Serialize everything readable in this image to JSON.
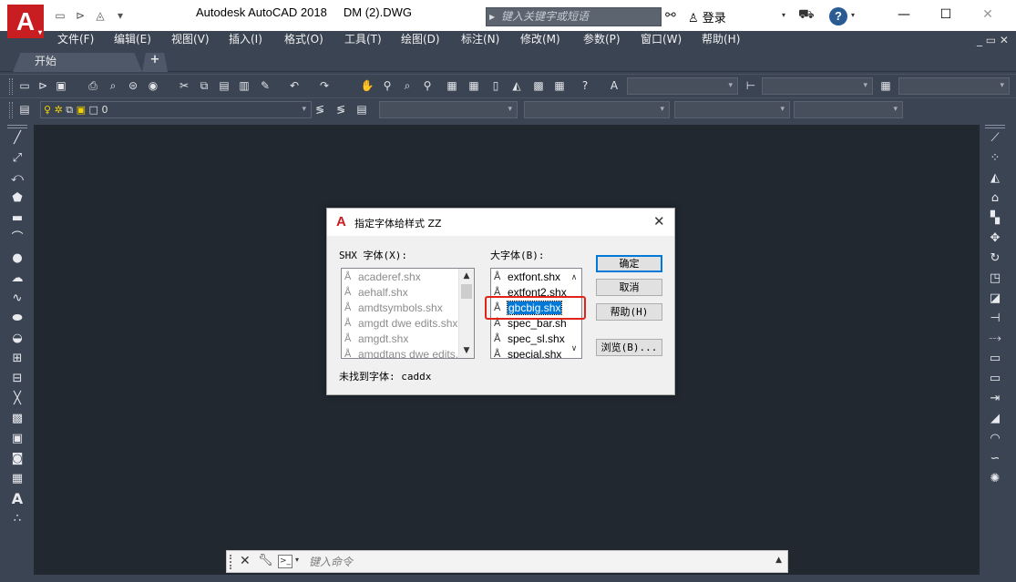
{
  "window": {
    "title": "Autodesk AutoCAD 2018     DM (2).DWG",
    "logo_letter": "A",
    "search_placeholder": "键入关键字或短语",
    "login_label": "登录",
    "help_label": "?",
    "minimize": "—",
    "maximize": "☐",
    "close": "✕"
  },
  "menu": {
    "items": [
      "文件(F)",
      "编辑(E)",
      "视图(V)",
      "插入(I)",
      "格式(O)",
      "工具(T)",
      "绘图(D)",
      "标注(N)",
      "修改(M)",
      "参数(P)",
      "窗口(W)",
      "帮助(H)"
    ],
    "window_controls": "_ ▭ ✕"
  },
  "file_tabs": {
    "start": "开始",
    "add": "+"
  },
  "layer_toolbar": {
    "current_layer": "0"
  },
  "command_line": {
    "placeholder": "键入命令"
  },
  "dialog": {
    "title": "指定字体给样式 ZZ",
    "close": "✕",
    "shx_label": "SHX 字体(X):",
    "big_label": "大字体(B):",
    "shx_fonts": [
      "acaderef.shx",
      "aehalf.shx",
      "amdtsymbols.shx",
      "amgdt dwe edits.shx",
      "amgdt.shx",
      "amgdtans dwe edits.shx"
    ],
    "big_fonts": [
      "extfont.shx",
      "extfont2.shx",
      "gbcbig.shx",
      "spec_bar.shx",
      "spec_sl.shx",
      "special.shx"
    ],
    "selected_big_font_index": 2,
    "buttons": {
      "ok": "确定",
      "cancel": "取消",
      "help": "帮助(H)",
      "browse": "浏览(B)..."
    },
    "missing_font_label": "未找到字体: caddx"
  },
  "colors": {
    "app_bg": "#3b4453",
    "canvas_bg": "#212830",
    "selection": "#0078d7",
    "highlight_annotation": "#e0241a",
    "brand_red": "#c81e22"
  }
}
